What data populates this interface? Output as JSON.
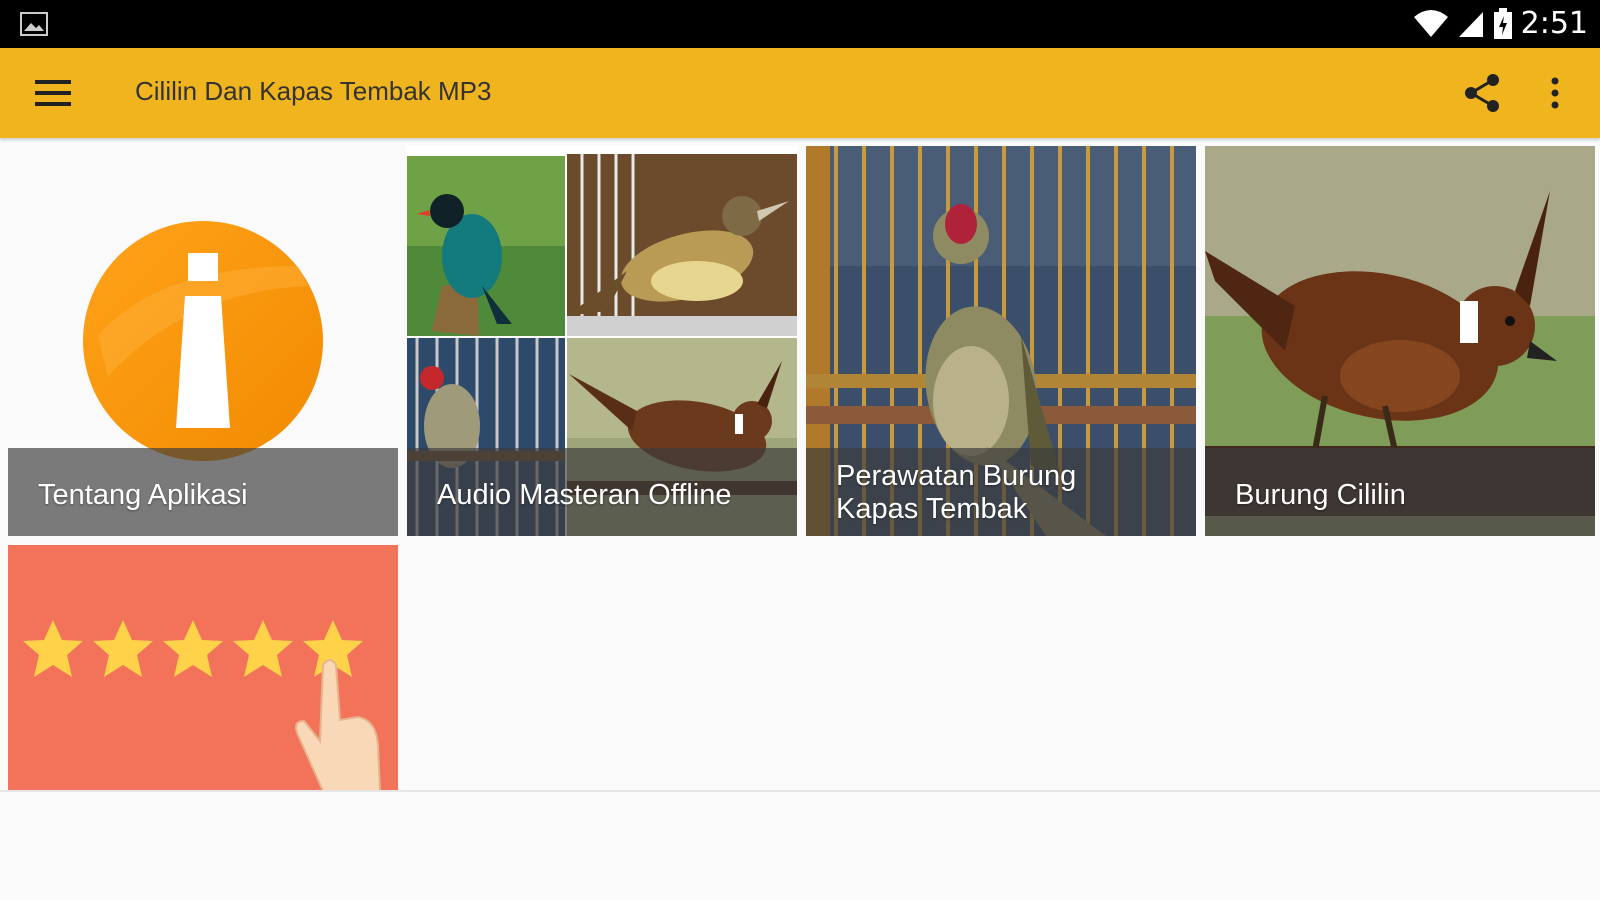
{
  "status_bar": {
    "time": "2:51",
    "icons": [
      "gallery-icon",
      "wifi-icon",
      "signal-icon",
      "battery-icon"
    ]
  },
  "app_bar": {
    "title": "Cililin Dan Kapas Tembak MP3",
    "background": "#f0b41e",
    "icons": [
      "menu-icon",
      "share-icon",
      "more-vert-icon"
    ]
  },
  "tiles": [
    {
      "label": "Tentang Aplikasi",
      "icon": "info-icon"
    },
    {
      "label": "Audio Masteran Offline",
      "icon": "bird-collage-image"
    },
    {
      "label_lines": [
        "Perawatan Burung",
        "Kapas Tembak"
      ],
      "icon": "caged-bird-image"
    },
    {
      "label": "Burung Cililin",
      "icon": "crested-bird-image"
    }
  ],
  "rate_tile": {
    "icon": "rating-stars-hand-icon",
    "stars": 5,
    "background": "#f2735a"
  }
}
